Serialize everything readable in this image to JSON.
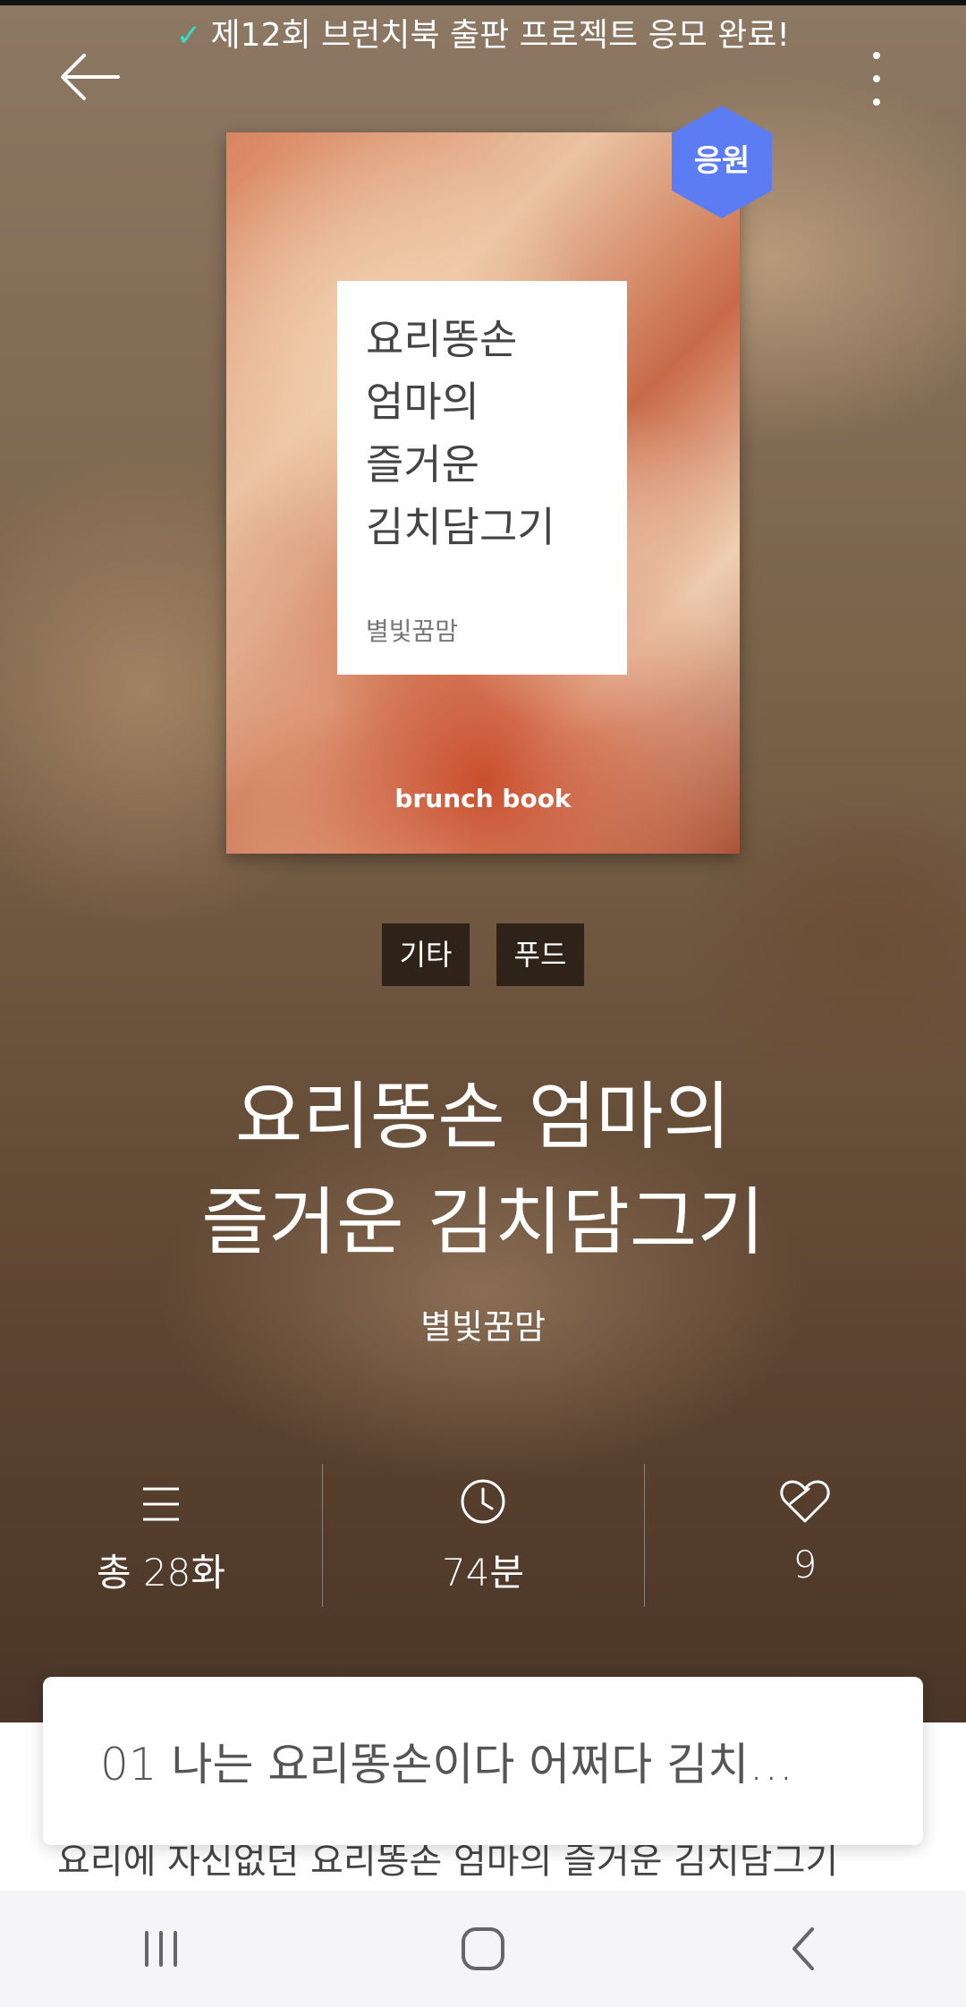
{
  "banner": {
    "text": "제12회 브런치북 출판 프로젝트 응모 완료!"
  },
  "header": {
    "back_icon": "arrow-left-icon",
    "more_icon": "more-vertical-icon"
  },
  "cover": {
    "title_lines": [
      "요리똥손",
      "엄마의",
      "즐거운",
      "김치담그기"
    ],
    "author": "별빛꿈맘",
    "brand": "brunch book",
    "badge": "응원",
    "badge_color": "#5b7cf2"
  },
  "tags": [
    "기타",
    "푸드"
  ],
  "book": {
    "title_line1": "요리똥손 엄마의",
    "title_line2": "즐거운 김치담그기",
    "author": "별빛꿈맘"
  },
  "stats": [
    {
      "icon": "list-icon",
      "value": "총 28화"
    },
    {
      "icon": "clock-icon",
      "value": "74분"
    },
    {
      "icon": "like-heart-icon",
      "value": "9"
    }
  ],
  "episode": {
    "text": "01  나는 요리똥손이다 어쩌다 김치…"
  },
  "description": {
    "text": "요리에 자신없던 요리똥손 엄마의 즐거운 김치담그기"
  },
  "navbar": {
    "recent_icon": "recent-apps-icon",
    "home_icon": "home-icon",
    "back_icon": "back-chevron-icon"
  }
}
